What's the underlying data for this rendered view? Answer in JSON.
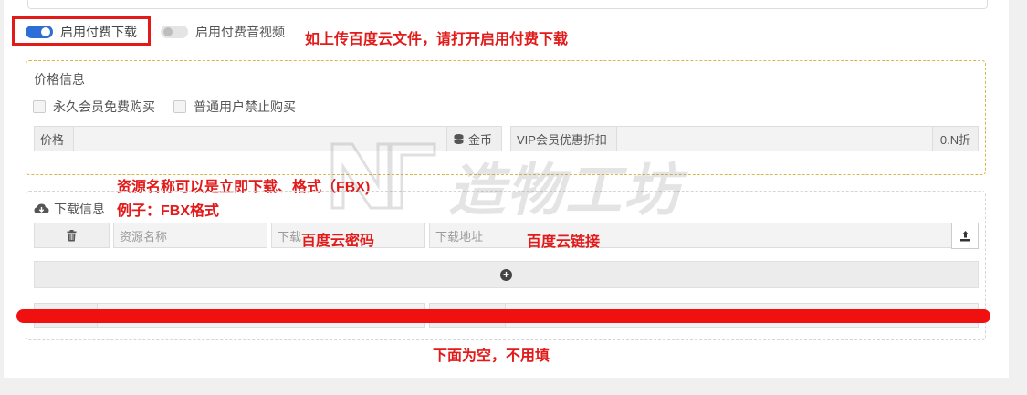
{
  "switches": {
    "paid_download": "启用付费下载",
    "paid_media": "启用付费音视频"
  },
  "annotations": {
    "upload_hint": "如上传百度云文件，请打开启用付费下载",
    "name_hint": "资源名称可以是立即下载、格式（FBX)",
    "example_hint": "例子：FBX格式",
    "password_hint": "百度云密码",
    "link_hint": "百度云链接",
    "empty_hint": "下面为空，不用填"
  },
  "price_section": {
    "title": "价格信息",
    "vip_free": "永久会员免费购买",
    "normal_forbid": "普通用户禁止购买",
    "price_label": "价格",
    "coin_label": "金币",
    "vip_discount_label": "VIP会员优惠折扣",
    "discount_suffix": "0.N折"
  },
  "download_section": {
    "title": "下载信息",
    "name_placeholder": "资源名称",
    "password_placeholder": "下载",
    "url_placeholder": "下载地址"
  },
  "watermark": {
    "brand": "造物工坊",
    "logo": "N"
  },
  "icons": [
    "trash-icon",
    "cloud-download-icon",
    "coins-icon",
    "upload-icon",
    "plus-circle-icon"
  ]
}
